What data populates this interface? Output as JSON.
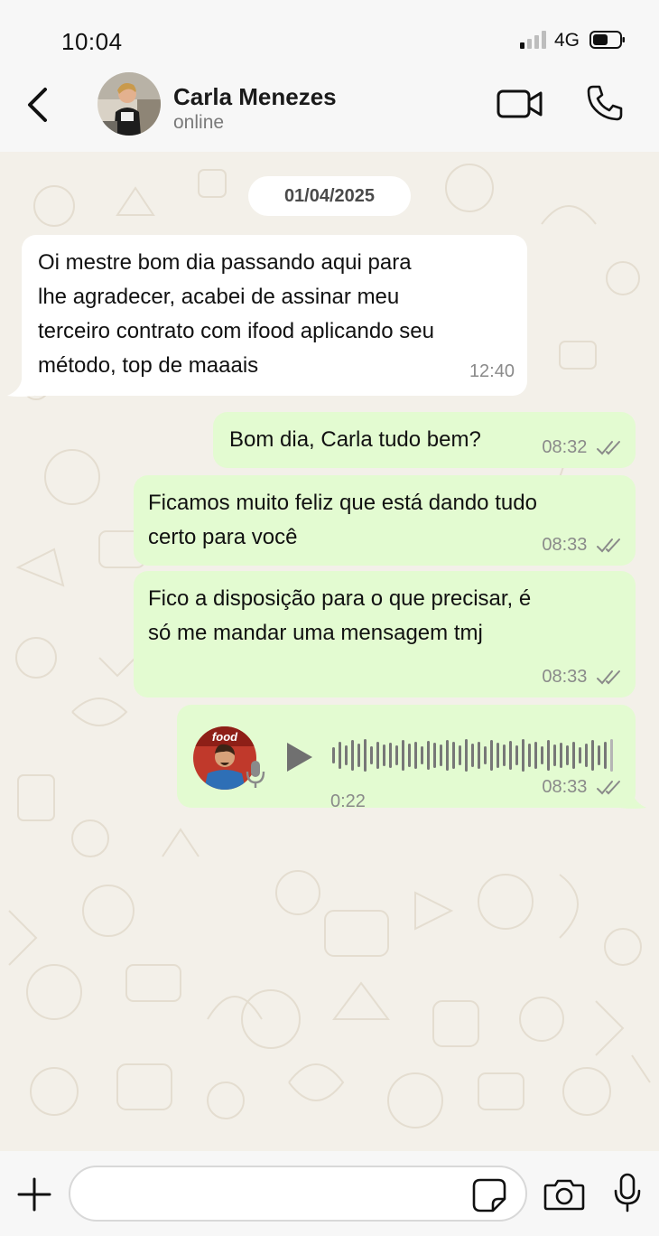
{
  "status_bar": {
    "time": "10:04",
    "network": "4G"
  },
  "header": {
    "contact_name": "Carla Menezes",
    "contact_status": "online"
  },
  "chat": {
    "date_chip": "01/04/2025",
    "messages": [
      {
        "direction": "in",
        "lines": [
          "Oi mestre bom dia passando aqui para",
          "lhe agradecer, acabei de assinar meu",
          "terceiro contrato com ifood aplicando seu",
          "método, top de maaais"
        ],
        "time": "12:40"
      },
      {
        "direction": "out",
        "lines": [
          "Bom dia, Carla tudo bem?"
        ],
        "time": "08:32"
      },
      {
        "direction": "out",
        "lines": [
          "Ficamos muito feliz que está dando tudo",
          "certo para você"
        ],
        "time": "08:33"
      },
      {
        "direction": "out",
        "lines": [
          "Fico a disposição para o que precisar, é",
          "só me mandar uma mensagem tmj"
        ],
        "time": "08:33"
      }
    ],
    "voice_message": {
      "duration": "0:22",
      "time": "08:33",
      "avatar_logo_text": "food",
      "played_fraction": 0
    }
  },
  "colors": {
    "incoming_bubble": "#ffffff",
    "outgoing_bubble": "#e3fbd1",
    "chat_background": "#f3f0e9",
    "ticks": "#8a8a8a"
  },
  "icons": {
    "back": "chevron-left-icon",
    "video": "video-camera-icon",
    "call": "phone-icon",
    "plus": "plus-icon",
    "sticker": "sticker-icon",
    "camera": "camera-icon",
    "mic": "microphone-icon"
  }
}
